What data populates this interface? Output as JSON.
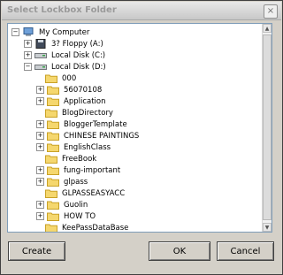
{
  "window": {
    "title": "Select Lockbox Folder",
    "close_glyph": "×"
  },
  "tree": {
    "items": [
      {
        "label": "My Computer",
        "icon": "computer-icon",
        "toggle": "−"
      },
      {
        "label": "3? Floppy (A:)",
        "icon": "floppy-icon",
        "toggle": "+"
      },
      {
        "label": "Local Disk (C:)",
        "icon": "drive-icon",
        "toggle": "+"
      },
      {
        "label": "Local Disk (D:)",
        "icon": "drive-icon",
        "toggle": "−"
      },
      {
        "label": "000",
        "icon": "folder-icon",
        "toggle": ""
      },
      {
        "label": "56070108",
        "icon": "folder-icon",
        "toggle": "+"
      },
      {
        "label": "Application",
        "icon": "folder-icon",
        "toggle": "+"
      },
      {
        "label": "BlogDirectory",
        "icon": "folder-icon",
        "toggle": ""
      },
      {
        "label": "BloggerTemplate",
        "icon": "folder-icon",
        "toggle": "+"
      },
      {
        "label": "CHINESE PAINTINGS",
        "icon": "folder-icon",
        "toggle": "+"
      },
      {
        "label": "EnglishClass",
        "icon": "folder-icon",
        "toggle": "+"
      },
      {
        "label": "FreeBook",
        "icon": "folder-icon",
        "toggle": ""
      },
      {
        "label": "fung-important",
        "icon": "folder-icon",
        "toggle": "+"
      },
      {
        "label": "glpass",
        "icon": "folder-icon",
        "toggle": "+"
      },
      {
        "label": "GLPASSEASYACC",
        "icon": "folder-icon",
        "toggle": ""
      },
      {
        "label": "Guolin",
        "icon": "folder-icon",
        "toggle": "+"
      },
      {
        "label": "HOW TO",
        "icon": "folder-icon",
        "toggle": "+"
      },
      {
        "label": "KeePassDataBase",
        "icon": "folder-icon",
        "toggle": ""
      }
    ]
  },
  "buttons": {
    "create": "Create",
    "ok": "OK",
    "cancel": "Cancel"
  },
  "colors": {
    "folder": "#f5d76e",
    "folder_edge": "#c9a227",
    "accent": "#7f9db9"
  }
}
